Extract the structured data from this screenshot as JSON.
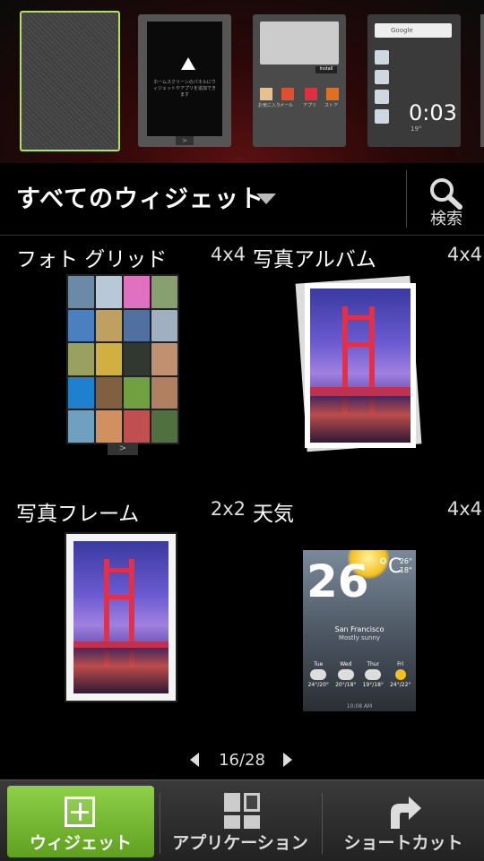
{
  "home_panels": {
    "panel2_text": "ホームスクリーンのパネルにウィジェットやアプリを追加できます",
    "panel2_nav": ">",
    "panel3_button": "Install",
    "panel3_items": [
      "お気に入り",
      "メール",
      "アプリ",
      "ストア"
    ],
    "panel4_search": "Google",
    "panel4_time": "0:03",
    "panel4_subtext": "19°"
  },
  "header": {
    "title": "すべてのウィジェット",
    "search_label": "検索"
  },
  "widgets": [
    {
      "name": "フォト グリッド",
      "size": "4x4"
    },
    {
      "name": "写真アルバム",
      "size": "4x4"
    },
    {
      "name": "写真フレーム",
      "size": "2x2"
    },
    {
      "name": "天気",
      "size": "4x4"
    }
  ],
  "weather_preview": {
    "temp": "26",
    "unit": "°C",
    "hi_lo": "26°\n18°",
    "city": "San Francisco",
    "condition": "Mostly sunny",
    "days": [
      {
        "name": "Tue",
        "temp": "24°/20°"
      },
      {
        "name": "Wed",
        "temp": "20°/18°"
      },
      {
        "name": "Thur",
        "temp": "19°/18°"
      },
      {
        "name": "Fri",
        "temp": "24°/22°"
      }
    ],
    "timestamp": "10:08 AM"
  },
  "photo_grid_nav": ">",
  "pager": {
    "current": "16/28"
  },
  "tabs": [
    {
      "label": "ウィジェット",
      "icon": "plus-box-icon"
    },
    {
      "label": "アプリケーション",
      "icon": "apps-grid-icon"
    },
    {
      "label": "ショートカット",
      "icon": "shortcut-arrow-icon"
    }
  ],
  "colors": {
    "accent": "#7cc13a",
    "selected_border": "#b8e060"
  }
}
